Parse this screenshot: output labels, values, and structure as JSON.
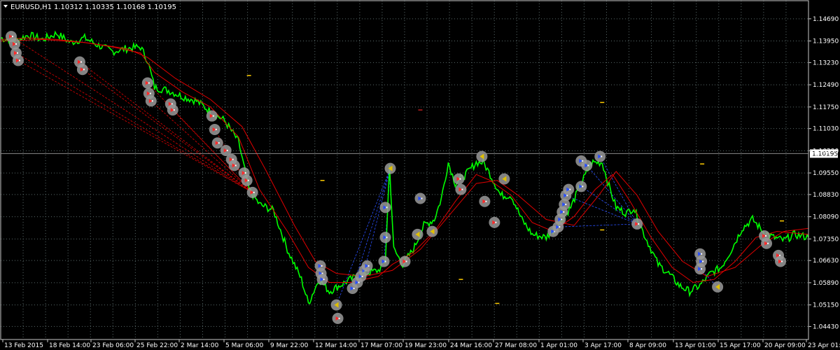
{
  "header": {
    "symbol": "EURUSD,H1",
    "ohlc": "1.10312 1.10335 1.10168 1.10195"
  },
  "colors": {
    "background": "#000000",
    "grid": "#5a6a6a",
    "price": "#00ff00",
    "ma": "#e00000",
    "buy_signal": "#2a50ff",
    "sell_signal": "#ff2a2a",
    "marker_halo": "#9a9a9a",
    "hint_dash": "#ffcc00",
    "axis_text": "#ffffff"
  },
  "chart_data": {
    "type": "line",
    "ylim": [
      1.0416,
      1.1492
    ],
    "y_ticks": [
      "1.14690",
      "1.13950",
      "1.13230",
      "1.12490",
      "1.11750",
      "1.11030",
      "1.10290",
      "1.09550",
      "1.08830",
      "1.08090",
      "1.07350",
      "1.06630",
      "1.05890",
      "1.05150",
      "1.04430"
    ],
    "x_ticks": [
      "13 Feb 2015",
      "18 Feb 14:00",
      "23 Feb 06:00",
      "25 Feb 22:00",
      "2 Mar 14:00",
      "5 Mar 06:00",
      "9 Mar 22:00",
      "12 Mar 14:00",
      "17 Mar 07:00",
      "19 Mar 23:00",
      "24 Mar 16:00",
      "27 Mar 08:00",
      "1 Apr 01:00",
      "3 Apr 17:00",
      "8 Apr 09:00",
      "13 Apr 01:00",
      "15 Apr 17:00",
      "20 Apr 09:00",
      "23 Apr 01:00"
    ],
    "current_price": "1.10195",
    "current_value": 1.10195,
    "x_range": [
      0,
      1155
    ],
    "series": [
      {
        "values": [
          [
            0,
            1.1405
          ],
          [
            20,
            1.1395
          ],
          [
            40,
            1.1415
          ],
          [
            60,
            1.14
          ],
          [
            80,
            1.142
          ],
          [
            100,
            1.139
          ],
          [
            120,
            1.1405
          ],
          [
            140,
            1.138
          ],
          [
            160,
            1.136
          ],
          [
            180,
            1.137
          ],
          [
            200,
            1.1375
          ],
          [
            210,
            1.133
          ],
          [
            220,
            1.124
          ],
          [
            240,
            1.123
          ],
          [
            260,
            1.121
          ],
          [
            280,
            1.1195
          ],
          [
            300,
            1.116
          ],
          [
            320,
            1.113
          ],
          [
            340,
            1.106
          ],
          [
            355,
            1.09
          ],
          [
            370,
            1.085
          ],
          [
            390,
            1.083
          ],
          [
            410,
            1.07
          ],
          [
            430,
            1.06
          ],
          [
            440,
            1.052
          ],
          [
            455,
            1.06
          ],
          [
            470,
            1.056
          ],
          [
            485,
            1.058
          ],
          [
            500,
            1.06
          ],
          [
            520,
            1.062
          ],
          [
            540,
            1.063
          ],
          [
            550,
            1.066
          ],
          [
            556,
            1.098
          ],
          [
            562,
            1.07
          ],
          [
            575,
            1.065
          ],
          [
            590,
            1.07
          ],
          [
            605,
            1.078
          ],
          [
            620,
            1.08
          ],
          [
            630,
            1.087
          ],
          [
            640,
            1.099
          ],
          [
            650,
            1.092
          ],
          [
            665,
            1.095
          ],
          [
            680,
            1.099
          ],
          [
            690,
            1.099
          ],
          [
            700,
            1.095
          ],
          [
            715,
            1.088
          ],
          [
            730,
            1.088
          ],
          [
            745,
            1.08
          ],
          [
            760,
            1.075
          ],
          [
            780,
            1.074
          ],
          [
            800,
            1.079
          ],
          [
            815,
            1.084
          ],
          [
            830,
            1.092
          ],
          [
            845,
            1.099
          ],
          [
            860,
            1.099
          ],
          [
            870,
            1.091
          ],
          [
            880,
            1.084
          ],
          [
            895,
            1.082
          ],
          [
            905,
            1.084
          ],
          [
            920,
            1.075
          ],
          [
            940,
            1.065
          ],
          [
            955,
            1.062
          ],
          [
            970,
            1.058
          ],
          [
            985,
            1.056
          ],
          [
            1000,
            1.058
          ],
          [
            1015,
            1.062
          ],
          [
            1030,
            1.064
          ],
          [
            1045,
            1.07
          ],
          [
            1060,
            1.077
          ],
          [
            1075,
            1.08
          ],
          [
            1090,
            1.076
          ],
          [
            1105,
            1.074
          ],
          [
            1120,
            1.073
          ],
          [
            1135,
            1.075
          ],
          [
            1155,
            1.074
          ]
        ]
      },
      {
        "values": [
          [
            0,
            1.14
          ],
          [
            40,
            1.1405
          ],
          [
            80,
            1.14
          ],
          [
            120,
            1.139
          ],
          [
            160,
            1.1375
          ],
          [
            200,
            1.1355
          ],
          [
            220,
            1.129
          ],
          [
            260,
            1.1225
          ],
          [
            300,
            1.1175
          ],
          [
            340,
            1.1075
          ],
          [
            370,
            1.09
          ],
          [
            410,
            1.076
          ],
          [
            440,
            1.064
          ],
          [
            470,
            1.059
          ],
          [
            500,
            1.059
          ],
          [
            540,
            1.061
          ],
          [
            560,
            1.065
          ],
          [
            590,
            1.069
          ],
          [
            620,
            1.076
          ],
          [
            650,
            1.086
          ],
          [
            680,
            1.095
          ],
          [
            700,
            1.093
          ],
          [
            730,
            1.088
          ],
          [
            760,
            1.079
          ],
          [
            790,
            1.076
          ],
          [
            820,
            1.081
          ],
          [
            850,
            1.09
          ],
          [
            875,
            1.095
          ],
          [
            900,
            1.086
          ],
          [
            930,
            1.074
          ],
          [
            960,
            1.064
          ],
          [
            990,
            1.059
          ],
          [
            1020,
            1.06
          ],
          [
            1050,
            1.066
          ],
          [
            1080,
            1.074
          ],
          [
            1110,
            1.076
          ],
          [
            1155,
            1.075
          ]
        ]
      },
      {
        "values": [
          [
            0,
            1.1395
          ],
          [
            60,
            1.14
          ],
          [
            120,
            1.139
          ],
          [
            180,
            1.137
          ],
          [
            210,
            1.134
          ],
          [
            250,
            1.127
          ],
          [
            300,
            1.12
          ],
          [
            345,
            1.111
          ],
          [
            380,
            1.096
          ],
          [
            420,
            1.078
          ],
          [
            450,
            1.066
          ],
          [
            480,
            1.062
          ],
          [
            520,
            1.061
          ],
          [
            560,
            1.063
          ],
          [
            600,
            1.07
          ],
          [
            640,
            1.081
          ],
          [
            680,
            1.092
          ],
          [
            710,
            1.093
          ],
          [
            740,
            1.088
          ],
          [
            780,
            1.08
          ],
          [
            820,
            1.078
          ],
          [
            855,
            1.088
          ],
          [
            880,
            1.096
          ],
          [
            910,
            1.088
          ],
          [
            940,
            1.076
          ],
          [
            975,
            1.066
          ],
          [
            1010,
            1.061
          ],
          [
            1050,
            1.064
          ],
          [
            1090,
            1.072
          ],
          [
            1120,
            1.076
          ],
          [
            1155,
            1.077
          ]
        ]
      }
    ],
    "markers": [
      {
        "x": 15,
        "y": 1.141,
        "type": "sell"
      },
      {
        "x": 20,
        "y": 1.1385,
        "type": "sell"
      },
      {
        "x": 22,
        "y": 1.1355,
        "type": "sell"
      },
      {
        "x": 25,
        "y": 1.133,
        "type": "sell"
      },
      {
        "x": 113,
        "y": 1.1325,
        "type": "sell"
      },
      {
        "x": 117,
        "y": 1.13,
        "type": "sell"
      },
      {
        "x": 210,
        "y": 1.1255,
        "type": "sell"
      },
      {
        "x": 212,
        "y": 1.122,
        "type": "sell"
      },
      {
        "x": 215,
        "y": 1.1195,
        "type": "sell"
      },
      {
        "x": 243,
        "y": 1.1185,
        "type": "sell"
      },
      {
        "x": 246,
        "y": 1.1165,
        "type": "sell"
      },
      {
        "x": 302,
        "y": 1.1145,
        "type": "sell"
      },
      {
        "x": 306,
        "y": 1.11,
        "type": "sell"
      },
      {
        "x": 310,
        "y": 1.1055,
        "type": "sell"
      },
      {
        "x": 322,
        "y": 1.103,
        "type": "sell"
      },
      {
        "x": 330,
        "y": 1.1,
        "type": "sell"
      },
      {
        "x": 334,
        "y": 1.098,
        "type": "sell"
      },
      {
        "x": 348,
        "y": 1.0955,
        "type": "sell"
      },
      {
        "x": 352,
        "y": 1.093,
        "type": "sell"
      },
      {
        "x": 360,
        "y": 1.089,
        "type": "sell"
      },
      {
        "x": 457,
        "y": 1.0645,
        "type": "buy"
      },
      {
        "x": 458,
        "y": 1.062,
        "type": "buy"
      },
      {
        "x": 460,
        "y": 1.06,
        "type": "buy"
      },
      {
        "x": 480,
        "y": 1.0515,
        "type": "neutral"
      },
      {
        "x": 482,
        "y": 1.047,
        "type": "sell"
      },
      {
        "x": 503,
        "y": 1.057,
        "type": "buy"
      },
      {
        "x": 510,
        "y": 1.059,
        "type": "buy"
      },
      {
        "x": 515,
        "y": 1.061,
        "type": "buy"
      },
      {
        "x": 520,
        "y": 1.063,
        "type": "buy"
      },
      {
        "x": 524,
        "y": 1.0645,
        "type": "buy"
      },
      {
        "x": 548,
        "y": 1.066,
        "type": "buy"
      },
      {
        "x": 550,
        "y": 1.074,
        "type": "buy"
      },
      {
        "x": 550,
        "y": 1.084,
        "type": "buy"
      },
      {
        "x": 557,
        "y": 1.097,
        "type": "neutral"
      },
      {
        "x": 578,
        "y": 1.066,
        "type": "sell"
      },
      {
        "x": 596,
        "y": 1.075,
        "type": "neutral"
      },
      {
        "x": 600,
        "y": 1.087,
        "type": "buy"
      },
      {
        "x": 617,
        "y": 1.076,
        "type": "neutral"
      },
      {
        "x": 655,
        "y": 1.0935,
        "type": "sell"
      },
      {
        "x": 658,
        "y": 1.09,
        "type": "sell"
      },
      {
        "x": 688,
        "y": 1.101,
        "type": "neutral"
      },
      {
        "x": 692,
        "y": 1.086,
        "type": "sell"
      },
      {
        "x": 706,
        "y": 1.079,
        "type": "sell"
      },
      {
        "x": 720,
        "y": 1.0935,
        "type": "neutral"
      },
      {
        "x": 790,
        "y": 1.076,
        "type": "buy"
      },
      {
        "x": 797,
        "y": 1.0775,
        "type": "buy"
      },
      {
        "x": 800,
        "y": 1.08,
        "type": "buy"
      },
      {
        "x": 803,
        "y": 1.0825,
        "type": "buy"
      },
      {
        "x": 806,
        "y": 1.085,
        "type": "buy"
      },
      {
        "x": 808,
        "y": 1.088,
        "type": "buy"
      },
      {
        "x": 812,
        "y": 1.09,
        "type": "buy"
      },
      {
        "x": 830,
        "y": 1.091,
        "type": "buy"
      },
      {
        "x": 830,
        "y": 1.0995,
        "type": "buy"
      },
      {
        "x": 838,
        "y": 1.098,
        "type": "buy"
      },
      {
        "x": 857,
        "y": 1.101,
        "type": "buy"
      },
      {
        "x": 910,
        "y": 1.0785,
        "type": "sell"
      },
      {
        "x": 1000,
        "y": 1.0685,
        "type": "buy"
      },
      {
        "x": 1002,
        "y": 1.066,
        "type": "buy"
      },
      {
        "x": 1000,
        "y": 1.0635,
        "type": "buy"
      },
      {
        "x": 1025,
        "y": 1.0575,
        "type": "neutral"
      },
      {
        "x": 1092,
        "y": 1.0745,
        "type": "sell"
      },
      {
        "x": 1095,
        "y": 1.072,
        "type": "sell"
      },
      {
        "x": 1112,
        "y": 1.068,
        "type": "sell"
      },
      {
        "x": 1115,
        "y": 1.066,
        "type": "sell"
      }
    ],
    "hint_dashes": [
      {
        "x": 355,
        "y": 1.128,
        "color": "yellow"
      },
      {
        "x": 460,
        "y": 1.093,
        "color": "yellow"
      },
      {
        "x": 600,
        "y": 1.1165,
        "color": "red"
      },
      {
        "x": 658,
        "y": 1.06,
        "color": "yellow"
      },
      {
        "x": 710,
        "y": 1.052,
        "color": "yellow"
      },
      {
        "x": 860,
        "y": 1.119,
        "color": "yellow"
      },
      {
        "x": 860,
        "y": 1.0765,
        "color": "yellow"
      },
      {
        "x": 1003,
        "y": 1.0985,
        "color": "yellow"
      },
      {
        "x": 1117,
        "y": 1.0795,
        "color": "yellow"
      }
    ],
    "fan_lines": [
      {
        "x1": 15,
        "y1": 1.141,
        "x2": 360,
        "y2": 1.089,
        "color": "red"
      },
      {
        "x1": 22,
        "y1": 1.1355,
        "x2": 360,
        "y2": 1.089,
        "color": "red"
      },
      {
        "x1": 25,
        "y1": 1.133,
        "x2": 360,
        "y2": 1.089,
        "color": "red"
      },
      {
        "x1": 113,
        "y1": 1.1325,
        "x2": 360,
        "y2": 1.089,
        "color": "red"
      },
      {
        "x1": 117,
        "y1": 1.13,
        "x2": 360,
        "y2": 1.089,
        "color": "red"
      },
      {
        "x1": 210,
        "y1": 1.1255,
        "x2": 360,
        "y2": 1.089,
        "color": "red"
      },
      {
        "x1": 215,
        "y1": 1.1195,
        "x2": 360,
        "y2": 1.089,
        "color": "red"
      },
      {
        "x1": 246,
        "y1": 1.1165,
        "x2": 360,
        "y2": 1.089,
        "color": "red"
      },
      {
        "x1": 306,
        "y1": 1.11,
        "x2": 360,
        "y2": 1.089,
        "color": "red"
      },
      {
        "x1": 330,
        "y1": 1.1,
        "x2": 360,
        "y2": 1.089,
        "color": "red"
      },
      {
        "x1": 480,
        "y1": 1.0515,
        "x2": 557,
        "y2": 1.097,
        "color": "blue"
      },
      {
        "x1": 503,
        "y1": 1.057,
        "x2": 557,
        "y2": 1.097,
        "color": "blue"
      },
      {
        "x1": 520,
        "y1": 1.063,
        "x2": 557,
        "y2": 1.097,
        "color": "blue"
      },
      {
        "x1": 548,
        "y1": 1.066,
        "x2": 557,
        "y2": 1.097,
        "color": "blue"
      },
      {
        "x1": 797,
        "y1": 1.0775,
        "x2": 910,
        "y2": 1.0785,
        "color": "blue"
      },
      {
        "x1": 808,
        "y1": 1.088,
        "x2": 910,
        "y2": 1.0785,
        "color": "blue"
      },
      {
        "x1": 830,
        "y1": 1.091,
        "x2": 910,
        "y2": 1.0785,
        "color": "blue"
      },
      {
        "x1": 838,
        "y1": 1.098,
        "x2": 910,
        "y2": 1.0785,
        "color": "blue"
      },
      {
        "x1": 857,
        "y1": 1.101,
        "x2": 910,
        "y2": 1.0785,
        "color": "blue"
      },
      {
        "x1": 1000,
        "y1": 1.0635,
        "x2": 1025,
        "y2": 1.0575,
        "color": "blue"
      }
    ]
  }
}
